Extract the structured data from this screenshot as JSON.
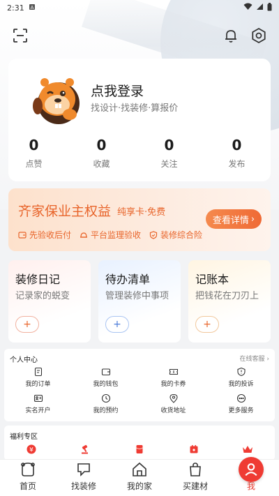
{
  "status_bar": {
    "time": "2:31"
  },
  "profile": {
    "login_title": "点我登录",
    "login_subtitle": "找设计·找装修·算报价",
    "stats": [
      {
        "value": "0",
        "label": "点赞"
      },
      {
        "value": "0",
        "label": "收藏"
      },
      {
        "value": "0",
        "label": "关注"
      },
      {
        "value": "0",
        "label": "发布"
      }
    ]
  },
  "banner": {
    "title": "齐家保业主权益",
    "subtitle": "纯享卡·免费",
    "button": "查看详情",
    "features": [
      "先验收后付",
      "平台监理验收",
      "装修综合险"
    ]
  },
  "quick_cards": [
    {
      "title": "装修日记",
      "subtitle": "记录家的蜕变",
      "add": "+"
    },
    {
      "title": "待办清单",
      "subtitle": "管理装修中事项",
      "add": "+"
    },
    {
      "title": "记账本",
      "subtitle": "把钱花在刀刃上",
      "add": "+"
    }
  ],
  "personal_center": {
    "title": "个人中心",
    "link": "在线客服",
    "items": [
      {
        "label": "我的订单",
        "icon": "order-icon"
      },
      {
        "label": "我的钱包",
        "icon": "wallet-icon"
      },
      {
        "label": "我的卡券",
        "icon": "coupon-icon"
      },
      {
        "label": "我的投诉",
        "icon": "complaint-icon"
      },
      {
        "label": "实名开户",
        "icon": "id-card-icon"
      },
      {
        "label": "我的预约",
        "icon": "clock-icon"
      },
      {
        "label": "收货地址",
        "icon": "location-icon"
      },
      {
        "label": "更多服务",
        "icon": "more-icon"
      }
    ]
  },
  "welfare": {
    "title": "福利专区"
  },
  "bottom_nav": [
    {
      "label": "首页"
    },
    {
      "label": "找装修"
    },
    {
      "label": "我的家"
    },
    {
      "label": "买建材"
    },
    {
      "label": "我"
    }
  ],
  "colors": {
    "accent": "#e8642a",
    "nav_active": "#ef3b33",
    "blue": "#4a7ad8"
  }
}
